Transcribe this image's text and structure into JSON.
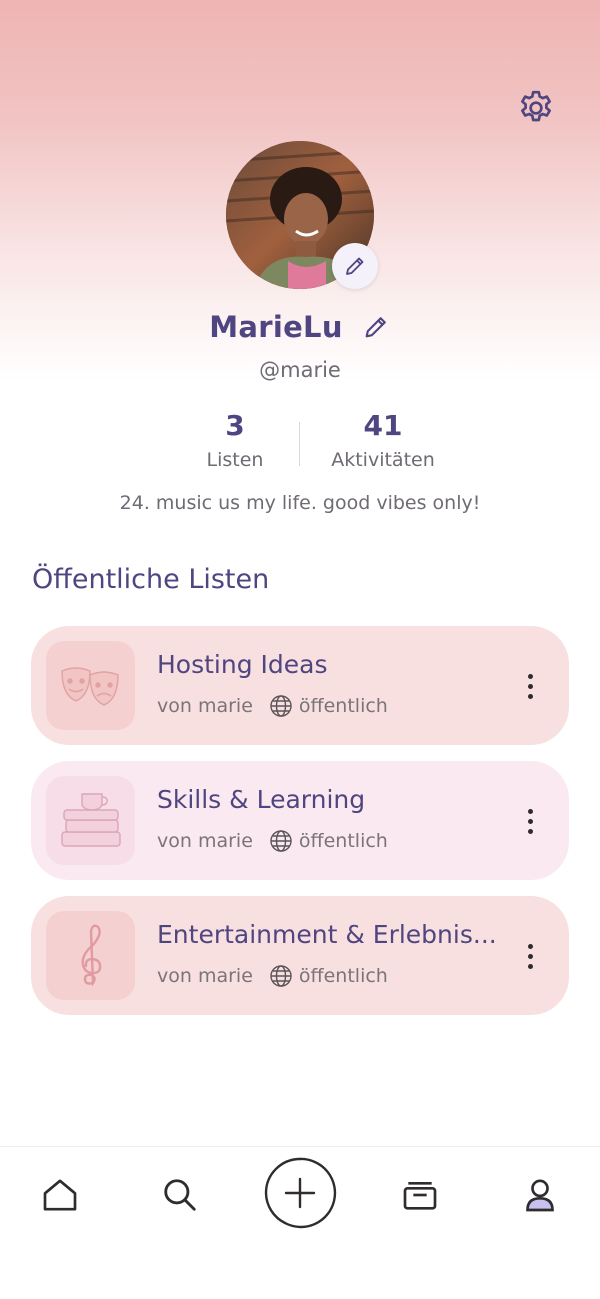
{
  "profile": {
    "name": "MarieLu",
    "handle": "@marie",
    "bio": "24. music us my life. good vibes only!",
    "avatar_icon": "profile-photo",
    "stats": [
      {
        "value": "3",
        "label": "Listen"
      },
      {
        "value": "41",
        "label": "Aktivitäten"
      }
    ]
  },
  "section": {
    "title": "Öffentliche Listen"
  },
  "lists": [
    {
      "title": "Hosting Ideas",
      "owner": "von marie",
      "visibility": "öffentlich",
      "icon": "theater-masks-icon",
      "color": "#f9e0e0"
    },
    {
      "title": "Skills & Learning",
      "owner": "von marie",
      "visibility": "öffentlich",
      "icon": "books-cup-icon",
      "color": "#fbe9f1"
    },
    {
      "title": "Entertainment & Erlebnis...",
      "owner": "von marie",
      "visibility": "öffentlich",
      "icon": "treble-clef-icon",
      "color": "#f9e0e0"
    }
  ],
  "nav": {
    "items": [
      "home-icon",
      "search-icon",
      "add-icon",
      "collection-icon",
      "profile-icon"
    ],
    "active": "profile-icon"
  },
  "colors": {
    "accent": "#4f4580",
    "header_top": "#efb4b4",
    "card_pink": "#f9e0e0",
    "card_lilac": "#fbe9f1"
  }
}
